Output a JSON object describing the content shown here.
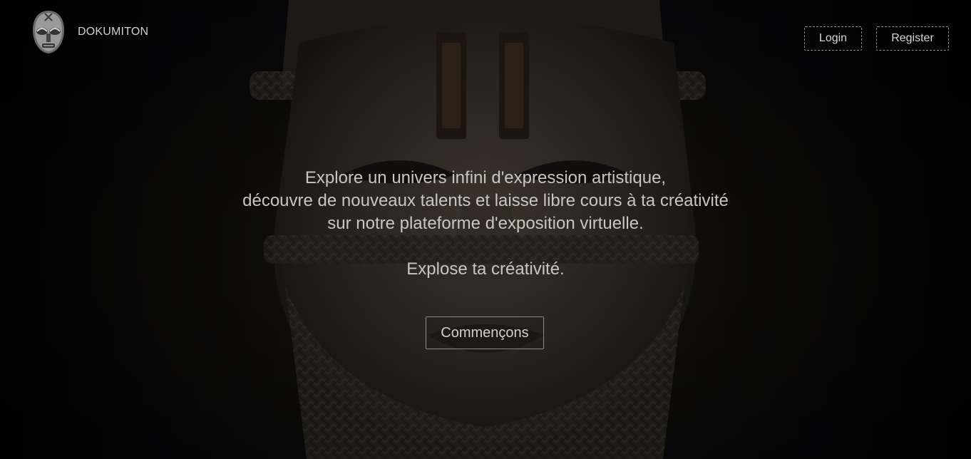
{
  "brand": {
    "name": "DOKUMITON",
    "logo_icon": "tribal-mask-icon"
  },
  "nav": {
    "login_label": "Login",
    "register_label": "Register"
  },
  "hero": {
    "line1": "Explore un univers infini d'expression artistique,",
    "line2": "découvre de nouveaux talents et laisse libre cours à ta créativité",
    "line3": "sur notre plateforme d'exposition virtuelle.",
    "tagline": "Explose ta créativité.",
    "cta_label": "Commençons",
    "background_image": "benin-ivory-mask-sculpture"
  },
  "colors": {
    "background": "#0a0a0d",
    "text": "#c9c6c1",
    "border": "#8b8b8b"
  }
}
